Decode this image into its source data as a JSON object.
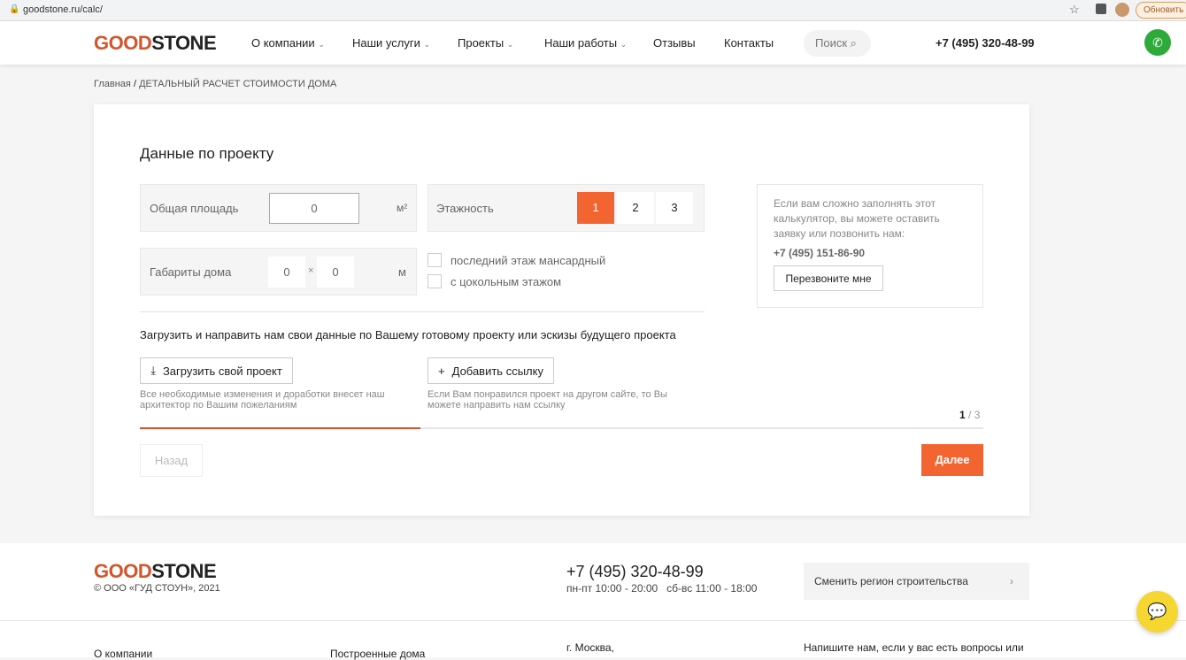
{
  "browser": {
    "url": "goodstone.ru/calc/",
    "update_label": "Обновить"
  },
  "header": {
    "logo_a": "GOOD",
    "logo_b": "STONE",
    "nav": [
      "О компании",
      "Наши услуги",
      "Проекты",
      "Наши работы",
      "Отзывы",
      "Контакты"
    ],
    "search": "Поиск",
    "phone": "+7 (495) 320-48-99"
  },
  "breadcrumb": {
    "home": "Главная",
    "sep": "/",
    "current": "ДЕТАЛЬНЫЙ РАСЧЕТ СТОИМОСТИ ДОМА"
  },
  "form": {
    "title": "Данные по проекту",
    "area_label": "Общая площадь",
    "area_value": "0",
    "area_unit": "м²",
    "floors_label": "Этажность",
    "floors": [
      "1",
      "2",
      "3"
    ],
    "dims_label": "Габариты дома",
    "dim_a": "0",
    "dim_x": "×",
    "dim_b": "0",
    "dims_unit": "м",
    "attic": "последний этаж мансардный",
    "basement": "с цокольным этажом",
    "upload_text": "Загрузить и направить нам свои данные по Вашему готовому проекту или эскизы будущего проекта",
    "upload_btn": "Загрузить свой проект",
    "upload_hint": "Все необходимые изменения и доработки внесет наш архитектор по Вашим пожеланиям",
    "link_btn": "Добавить ссылку",
    "link_hint": "Если Вам понравился проект на другом сайте, то Вы можете направить нам ссылку",
    "step": "1",
    "step_total": "/ 3",
    "progress": 0.333,
    "back": "Назад",
    "next": "Далее"
  },
  "help": {
    "text": "Если вам сложно заполнять этот калькулятор, вы можете оставить заявку или позвонить нам:",
    "phone": "+7 (495) 151-86-90",
    "callback": "Перезвоните мне"
  },
  "footer": {
    "copyright": "© ООО «ГУД СТОУН», 2021",
    "phone": "+7 (495) 320-48-99",
    "hours": "пн-пт 10:00 - 20:00   сб-вс 11:00 - 18:00",
    "region": "Сменить регион строительства",
    "links": [
      "О компании",
      "Построенные дома"
    ],
    "city": "г. Москва,",
    "write": "Напишите нам, если у вас есть вопросы или"
  },
  "colors": {
    "accent": "#f26531",
    "green": "#2eaa3a"
  }
}
